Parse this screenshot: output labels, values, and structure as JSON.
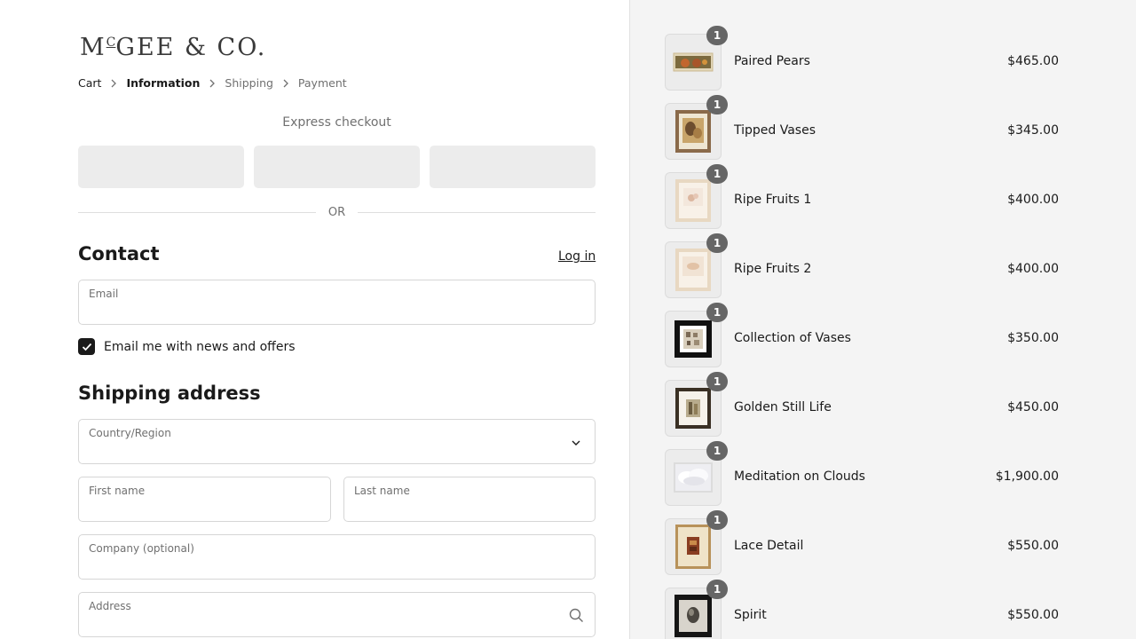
{
  "brand": {
    "name_main": "M",
    "name_sup": "C",
    "name_rest": "GEE & CO."
  },
  "breadcrumb": [
    {
      "label": "Cart",
      "state": "link"
    },
    {
      "label": "Information",
      "state": "current"
    },
    {
      "label": "Shipping",
      "state": "upcoming"
    },
    {
      "label": "Payment",
      "state": "upcoming"
    }
  ],
  "express": {
    "label": "Express checkout",
    "separator": "OR"
  },
  "contact": {
    "title": "Contact",
    "login_label": "Log in",
    "email_label": "Email",
    "email_value": "",
    "newsletter_label": "Email me with news and offers",
    "newsletter_checked": true
  },
  "shipping": {
    "title": "Shipping address",
    "country_label": "Country/Region",
    "first_name_label": "First name",
    "last_name_label": "Last name",
    "company_label": "Company (optional)",
    "address_label": "Address"
  },
  "icons": {
    "chevron": "chevron-right-icon",
    "select": "chevron-down-icon",
    "search": "search-icon",
    "check": "checkmark-icon"
  },
  "colors": {
    "text": "#1a1a1a",
    "muted": "#707070",
    "summary_bg": "#f4f4f4",
    "badge": "#666666",
    "express_button": "#ececec"
  },
  "cart_items": [
    {
      "name": "Paired Pears",
      "price": "$465.00",
      "quantity": "1"
    },
    {
      "name": "Tipped Vases",
      "price": "$345.00",
      "quantity": "1"
    },
    {
      "name": "Ripe Fruits 1",
      "price": "$400.00",
      "quantity": "1"
    },
    {
      "name": "Ripe Fruits 2",
      "price": "$400.00",
      "quantity": "1"
    },
    {
      "name": "Collection of Vases",
      "price": "$350.00",
      "quantity": "1"
    },
    {
      "name": "Golden Still Life",
      "price": "$450.00",
      "quantity": "1"
    },
    {
      "name": "Meditation on Clouds",
      "price": "$1,900.00",
      "quantity": "1"
    },
    {
      "name": "Lace Detail",
      "price": "$550.00",
      "quantity": "1"
    },
    {
      "name": "Spirit",
      "price": "$550.00",
      "quantity": "1"
    }
  ]
}
